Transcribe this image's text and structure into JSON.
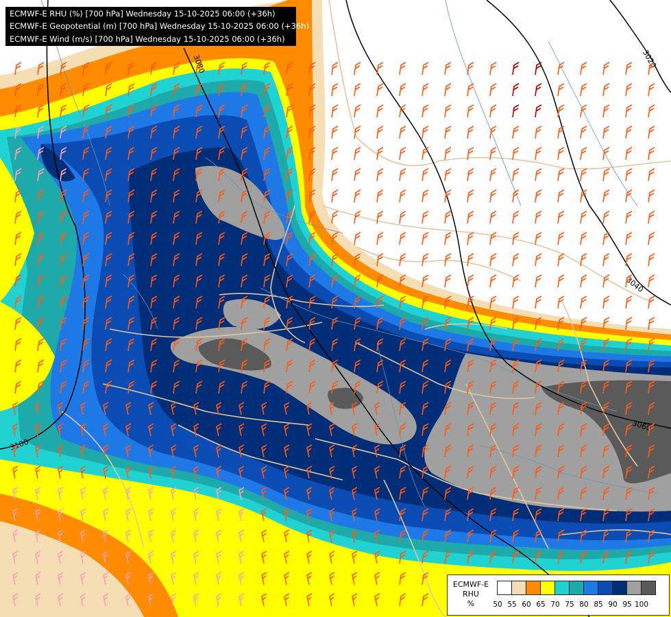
{
  "titles": [
    "ECMWF-E RHU (%) [700 hPa] Wednesday 15-10-2025 06:00 (+36h)",
    "ECMWF-E Geopotential (m) [700 hPa] Wednesday 15-10-2025 06:00 (+36h)",
    "ECMWF-E Wind (m/s) [700 hPa] Wednesday 15-10-2025 06:00 (+36h)"
  ],
  "contour_labels": [
    "3020",
    "3040",
    "3060",
    "3080",
    "3100"
  ],
  "legend": {
    "model": "ECMWF-E",
    "variable": "RHU",
    "unit": "%",
    "ticks": [
      "50",
      "55",
      "60",
      "65",
      "70",
      "75",
      "80",
      "85",
      "90",
      "95",
      "100"
    ],
    "colors": [
      "#ffffff",
      "#f5deb3",
      "#ff8c00",
      "#ffff00",
      "#20d2d2",
      "#1eaaaa",
      "#1e78e6",
      "#0a4bb4",
      "#002d78",
      "#a0a0a0",
      "#5a5a5a"
    ]
  },
  "colors": {
    "border": "#e0c8a0",
    "river": "#6495b4",
    "barb": "#ff5a14",
    "barb_light": "#ffa0b4",
    "barb_strong": "#b40000",
    "isohypse": "#000000"
  }
}
